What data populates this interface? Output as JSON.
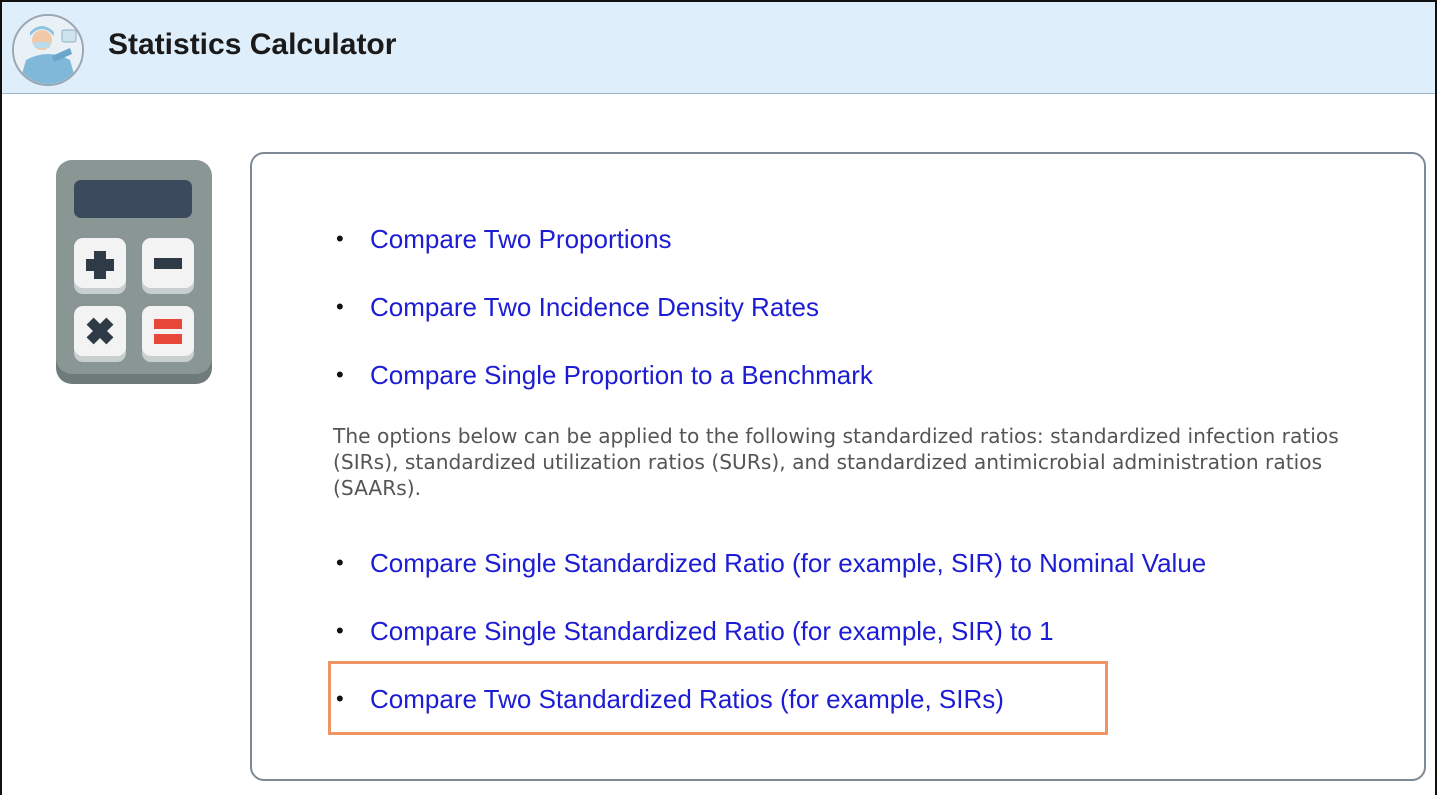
{
  "header": {
    "title": "Statistics Calculator",
    "avatar_icon": "healthcare-worker-avatar-icon"
  },
  "sidebar": {
    "calculator_icon": "calculator-icon"
  },
  "links_top": [
    {
      "label": "Compare Two Proportions"
    },
    {
      "label": "Compare Two Incidence Density Rates"
    },
    {
      "label": "Compare Single Proportion to a Benchmark"
    }
  ],
  "description": "The options below can be applied to the following standardized ratios: standardized infection ratios (SIRs), standardized utilization ratios (SURs), and standardized antimicrobial administration ratios (SAARs).",
  "links_bottom": [
    {
      "label": "Compare Single Standardized Ratio (for example, SIR) to Nominal Value"
    },
    {
      "label": "Compare Single Standardized Ratio (for example, SIR) to 1"
    },
    {
      "label": "Compare Two Standardized Ratios (for example, SIRs)"
    }
  ],
  "colors": {
    "header_bg": "#deeefb",
    "link": "#1c1cd4",
    "highlight_border": "#f09366",
    "calc_body": "#8a9694",
    "calc_screen": "#3b4a5c",
    "calc_equals": "#e8483a"
  }
}
